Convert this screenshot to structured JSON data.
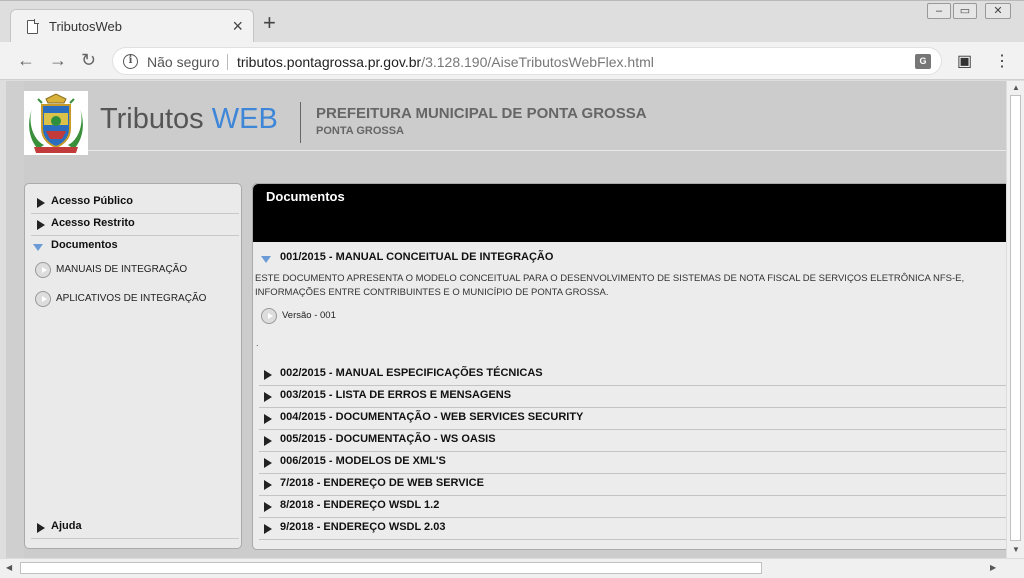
{
  "browser": {
    "tab_title": "TributosWeb",
    "tab_close": "×",
    "new_tab": "+",
    "security_label": "Não seguro",
    "url_host": "tributos.pontagrossa.pr.gov.br",
    "url_path": "/3.128.190/AiseTributosWebFlex.html",
    "translate_label": "G"
  },
  "header": {
    "brand_main": "Tributos ",
    "brand_accent": "WEB",
    "prefeitura": "PREFEITURA MUNICIPAL DE PONTA GROSSA",
    "city": "PONTA GROSSA"
  },
  "sidebar": {
    "items": [
      {
        "label": "Acesso Público"
      },
      {
        "label": "Acesso Restrito"
      },
      {
        "label": "Documentos"
      }
    ],
    "subitems": [
      {
        "label": "MANUAIS DE INTEGRAÇÃO"
      },
      {
        "label": "APLICATIVOS DE INTEGRAÇÃO"
      }
    ],
    "help": "Ajuda"
  },
  "main": {
    "title": "Documentos",
    "expanded_doc": "001/2015 - MANUAL CONCEITUAL DE INTEGRAÇÃO",
    "description_1": "ESTE DOCUMENTO APRESENTA O MODELO CONCEITUAL PARA O DESENVOLVIMENTO DE SISTEMAS DE NOTA FISCAL DE SERVIÇOS ELETRÔNICA NFS-E,",
    "description_2": "INFORMAÇÕES ENTRE CONTRIBUINTES E O MUNICÍPIO DE PONTA GROSSA.",
    "version": "Versão - 001",
    "dot": ".",
    "docs": [
      {
        "label": "002/2015 - MANUAL ESPECIFICAÇÕES TÉCNICAS"
      },
      {
        "label": "003/2015 - LISTA DE ERROS E MENSAGENS"
      },
      {
        "label": "004/2015 - DOCUMENTAÇÃO - WEB SERVICES SECURITY"
      },
      {
        "label": "005/2015 - DOCUMENTAÇÃO - WS OASIS"
      },
      {
        "label": "006/2015 - MODELOS DE XML'S"
      },
      {
        "label": "7/2018 - ENDEREÇO DE WEB SERVICE"
      },
      {
        "label": "8/2018 - ENDEREÇO WSDL 1.2"
      },
      {
        "label": "9/2018 - ENDEREÇO WSDL 2.03"
      }
    ]
  }
}
